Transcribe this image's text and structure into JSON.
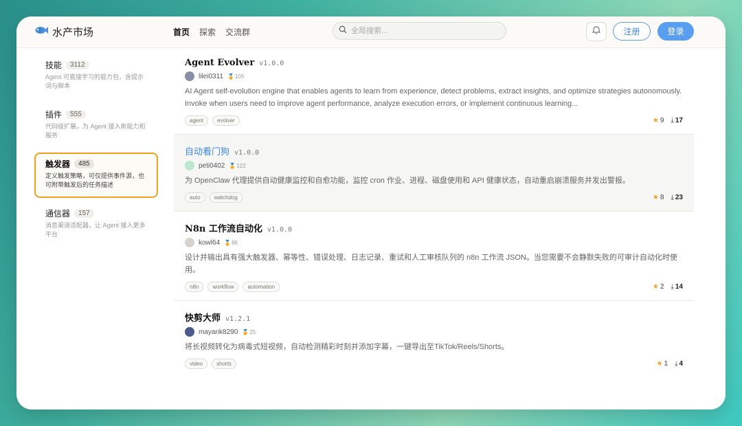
{
  "header": {
    "brand": "水产市场",
    "nav": [
      {
        "label": "首页",
        "active": true
      },
      {
        "label": "探索",
        "active": false
      },
      {
        "label": "交流群",
        "active": false
      }
    ],
    "search_placeholder": "全局搜索...",
    "register": "注册",
    "login": "登录"
  },
  "sidebar": {
    "items": [
      {
        "name": "技能",
        "count": "3112",
        "desc": "Agent 可直接学习的能力包，含提示词与脚本",
        "active": false
      },
      {
        "name": "插件",
        "count": "555",
        "desc": "代码级扩展，为 Agent 接入新能力和服务",
        "active": false
      },
      {
        "name": "触发器",
        "count": "485",
        "desc": "定义触发策略，可仅提供事件源，也可附带触发后的任务描述",
        "active": true
      },
      {
        "name": "通信器",
        "count": "157",
        "desc": "消息渠道适配器，让 Agent 接入更多平台",
        "active": false
      }
    ]
  },
  "cards": [
    {
      "title": "Agent Evolver",
      "version": "v1.0.0",
      "author": "lilei0311",
      "rep": "105",
      "desc": "AI Agent self-evolution engine that enables agents to learn from experience, detect problems, extract insights, and optimize strategies autonomously. Invoke when users need to improve agent performance, analyze execution errors, or implement continuous learning...",
      "tags": [
        "agent",
        "evolver"
      ],
      "stars": "9",
      "downloads": "17"
    },
    {
      "title": "自动看门狗",
      "version": "v1.0.0",
      "author": "peti0402",
      "rep": "122",
      "desc": "为 OpenClaw 代理提供自动健康监控和自愈功能，监控 cron 作业、进程、磁盘使用和 API 健康状态，自动重启崩溃服务并发出警报。",
      "tags": [
        "auto",
        "watchdog"
      ],
      "stars": "8",
      "downloads": "23"
    },
    {
      "title": "N8n 工作流自动化",
      "version": "v1.0.0",
      "author": "kowl64",
      "rep": "86",
      "desc": "设计并输出具有强大触发器、幂等性、错误处理、日志记录、重试和人工审核队列的 n8n 工作流 JSON。当您需要不会静默失败的可审计自动化时使用。",
      "tags": [
        "n8n",
        "workflow",
        "automation"
      ],
      "stars": "2",
      "downloads": "14"
    },
    {
      "title": "快剪大师",
      "version": "v1.2.1",
      "author": "mayank8290",
      "rep": "25",
      "desc": "将长视频转化为病毒式短视频，自动检测精彩时刻并添加字幕，一键导出至TikTok/Reels/Shorts。",
      "tags": [
        "video",
        "shorts"
      ],
      "stars": "1",
      "downloads": "4"
    }
  ],
  "colors": {
    "accent": "#5a9ef0",
    "active_border": "#f0a020",
    "star": "#f0a020"
  }
}
